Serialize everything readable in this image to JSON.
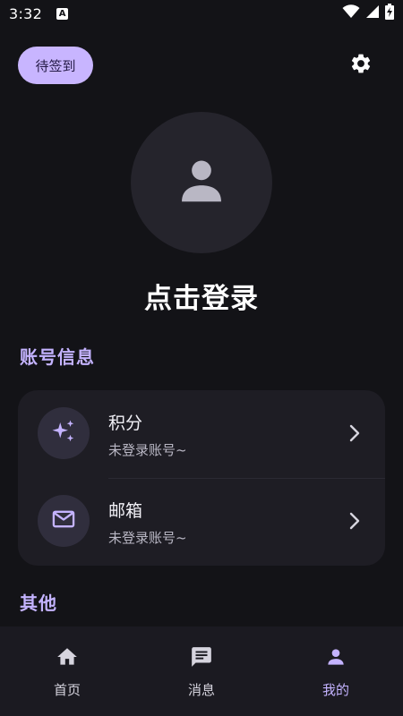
{
  "status_bar": {
    "time": "3:32",
    "notification_glyph": "A",
    "icons": [
      "wifi-icon",
      "cellular-signal-icon",
      "battery-charging-icon"
    ]
  },
  "header": {
    "checkin_label": "待签到",
    "settings_icon": "gear-icon"
  },
  "profile": {
    "avatar_icon": "person-icon",
    "login_label": "点击登录"
  },
  "sections": {
    "account_title": "账号信息",
    "other_title": "其他"
  },
  "account_items": [
    {
      "icon": "sparkles-icon",
      "title": "积分",
      "subtitle": "未登录账号~"
    },
    {
      "icon": "mail-icon",
      "title": "邮箱",
      "subtitle": "未登录账号~"
    }
  ],
  "bottom_nav": {
    "items": [
      {
        "icon": "home-icon",
        "label": "首页",
        "active": false
      },
      {
        "icon": "message-icon",
        "label": "消息",
        "active": false
      },
      {
        "icon": "person-icon",
        "label": "我的",
        "active": true
      }
    ]
  },
  "colors": {
    "background": "#131317",
    "accent": "#c4b3ff",
    "checkin_button": "#c8b5ff",
    "card": "#1e1d24",
    "nav_bar": "#1b1a21"
  }
}
